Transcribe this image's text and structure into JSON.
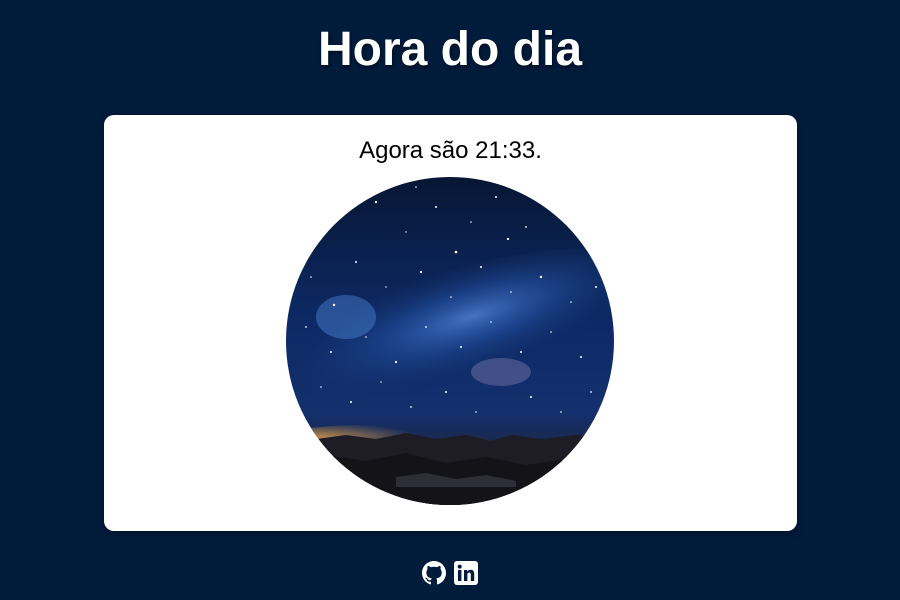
{
  "header": {
    "title": "Hora do dia"
  },
  "card": {
    "time_text": "Agora são 21:33.",
    "image": {
      "icon": "night-sky-photo",
      "colors": {
        "sky_top": "#071634",
        "sky_mid": "#0f2d6e",
        "milky_way": "#2f6fd1",
        "horizon_glow": "#c98a3c",
        "mountains": "#16161c"
      }
    }
  },
  "footer": {
    "links": [
      {
        "icon": "github-icon"
      },
      {
        "icon": "linkedin-icon"
      }
    ]
  },
  "colors": {
    "background": "#011b3b",
    "card_background": "#ffffff",
    "title": "#ffffff",
    "text": "#000000"
  }
}
